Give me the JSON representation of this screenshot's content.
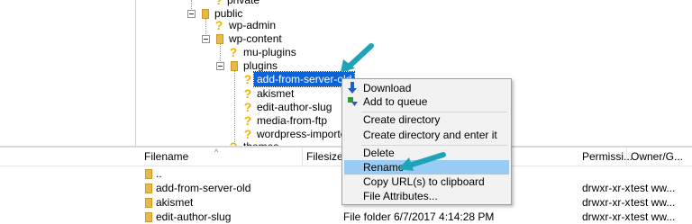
{
  "tree": {
    "nodes": [
      {
        "label": "private",
        "indent": 244
      },
      {
        "label": "public"
      },
      {
        "label": "wp-admin"
      },
      {
        "label": "wp-content"
      },
      {
        "label": "mu-plugins"
      },
      {
        "label": "plugins"
      },
      {
        "label": "add-from-server-old"
      },
      {
        "label": "akismet"
      },
      {
        "label": "edit-author-slug"
      },
      {
        "label": "media-from-ftp"
      },
      {
        "label": "wordpress-importer"
      },
      {
        "label": "themes"
      }
    ]
  },
  "context_menu": {
    "items": [
      {
        "label": "Download",
        "icon": "download-arrow-icon"
      },
      {
        "label": "Add to queue",
        "icon": "add-to-queue-icon"
      },
      {
        "label": "Create directory"
      },
      {
        "label": "Create directory and enter it"
      },
      {
        "label": "Delete"
      },
      {
        "label": "Rename"
      },
      {
        "label": "Copy URL(s) to clipboard"
      },
      {
        "label": "File Attributes..."
      }
    ],
    "highlighted": "Rename"
  },
  "list": {
    "headers": {
      "filename": "Filename",
      "filesize": "Filesize",
      "permissions": "Permissi...",
      "owner": "Owner/G..."
    },
    "rows": [
      {
        "name": "..",
        "type": "",
        "perm": "",
        "owner": ""
      },
      {
        "name": "add-from-server-old",
        "type": "",
        "perm": "drwxr-xr-x",
        "owner": "test ww..."
      },
      {
        "name": "akismet",
        "type": "",
        "perm": "drwxr-xr-x",
        "owner": "test ww..."
      },
      {
        "name": "edit-author-slug",
        "type": "File folder",
        "modified": "6/7/2017 4:14:28 PM",
        "perm": "drwxr-xr-x",
        "owner": "test ww..."
      }
    ]
  },
  "colors": {
    "selection": "#0a64d8",
    "menu_highlight": "#99ccf5",
    "arrow": "#1fa3b8",
    "folder": "#e8b84a"
  }
}
